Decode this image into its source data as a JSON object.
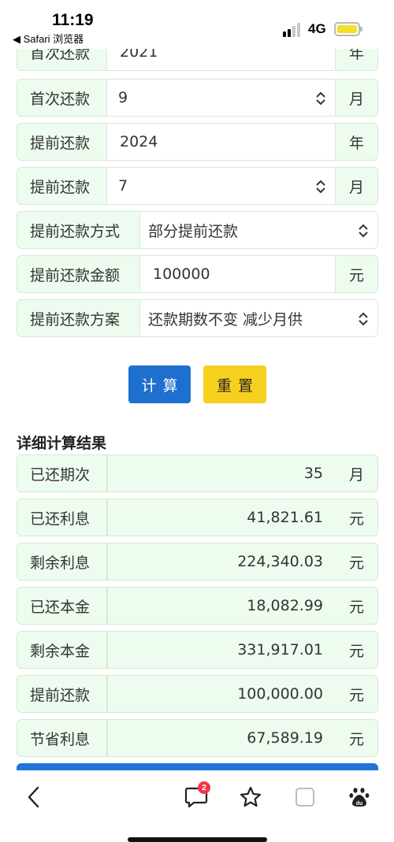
{
  "status_bar": {
    "time": "11:19",
    "back_app": "◀ Safari 浏览器",
    "network": "4G",
    "battery_color": "#f6dd2a"
  },
  "form": {
    "rows": [
      {
        "label": "首次还款",
        "value": "2021",
        "unit": "年",
        "type": "text"
      },
      {
        "label": "首次还款",
        "value": "9",
        "unit": "月",
        "type": "select"
      },
      {
        "label": "提前还款",
        "value": "2024",
        "unit": "年",
        "type": "text"
      },
      {
        "label": "提前还款",
        "value": "7",
        "unit": "月",
        "type": "select"
      },
      {
        "label": "提前还款方式",
        "value": "部分提前还款",
        "type": "select"
      },
      {
        "label": "提前还款金额",
        "value": "100000",
        "unit": "元",
        "type": "text"
      },
      {
        "label": "提前还款方案",
        "value": "还款期数不变 减少月供",
        "type": "select"
      }
    ]
  },
  "buttons": {
    "calculate": "计算",
    "reset": "重置",
    "calculate_color": "#1f6fcf",
    "reset_color": "#f7cf1f"
  },
  "results": {
    "title": "详细计算结果",
    "rows": [
      {
        "label": "已还期次",
        "value": "35",
        "unit": "月"
      },
      {
        "label": "已还利息",
        "value": "41,821.61",
        "unit": "元"
      },
      {
        "label": "剩余利息",
        "value": "224,340.03",
        "unit": "元"
      },
      {
        "label": "已还本金",
        "value": "18,082.99",
        "unit": "元"
      },
      {
        "label": "剩余本金",
        "value": "331,917.01",
        "unit": "元"
      },
      {
        "label": "提前还款",
        "value": "100,000.00",
        "unit": "元"
      },
      {
        "label": "节省利息",
        "value": "67,589.19",
        "unit": "元"
      }
    ]
  },
  "toolbar": {
    "items": [
      "back-icon",
      "comments-icon",
      "star-icon",
      "tabs-icon",
      "baidu-icon"
    ],
    "comment_count": "2"
  }
}
